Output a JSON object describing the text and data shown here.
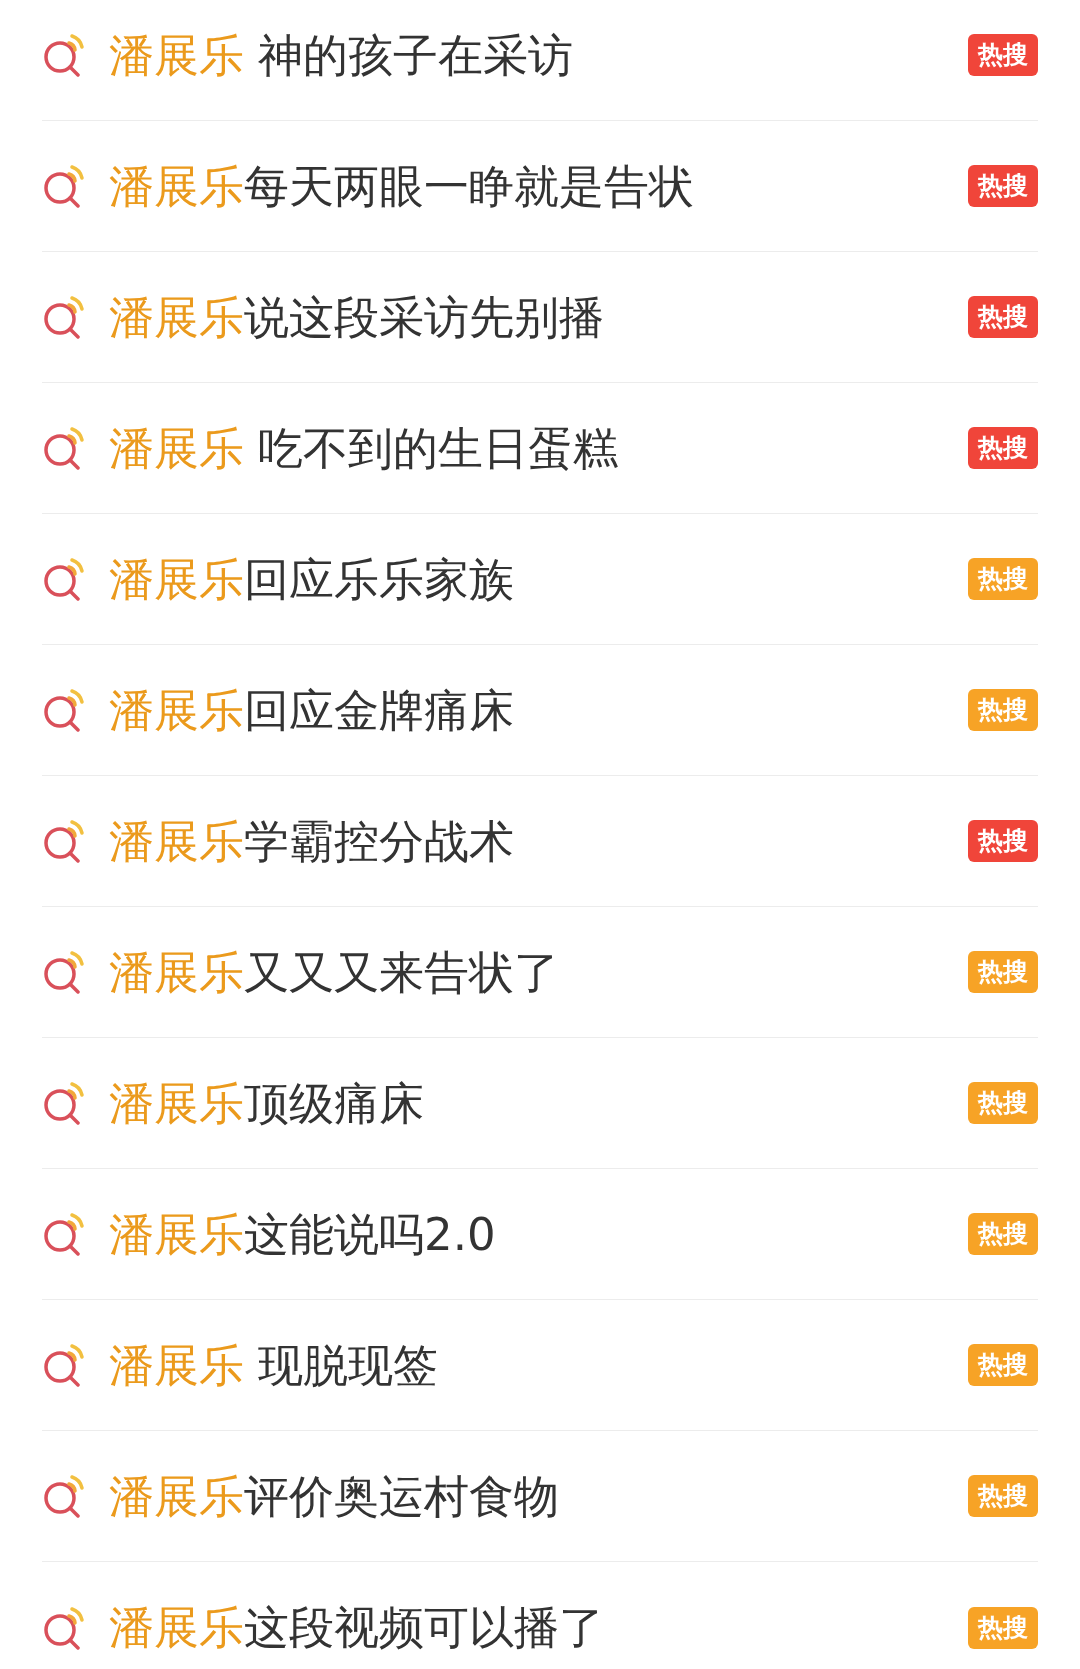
{
  "results": [
    {
      "keyword": "潘展乐",
      "text": " 神的孩子在采访",
      "badge": {
        "text": "热搜",
        "color": "#f0453a"
      }
    },
    {
      "keyword": "潘展乐",
      "text": "每天两眼一睁就是告状",
      "badge": {
        "text": "热搜",
        "color": "#f0453a"
      }
    },
    {
      "keyword": "潘展乐",
      "text": "说这段采访先别播",
      "badge": {
        "text": "热搜",
        "color": "#f0453a"
      }
    },
    {
      "keyword": "潘展乐",
      "text": " 吃不到的生日蛋糕",
      "badge": {
        "text": "热搜",
        "color": "#f0453a"
      }
    },
    {
      "keyword": "潘展乐",
      "text": "回应乐乐家族",
      "badge": {
        "text": "热搜",
        "color": "#f7a326"
      }
    },
    {
      "keyword": "潘展乐",
      "text": "回应金牌痛床",
      "badge": {
        "text": "热搜",
        "color": "#f7a326"
      }
    },
    {
      "keyword": "潘展乐",
      "text": "学霸控分战术",
      "badge": {
        "text": "热搜",
        "color": "#f0453a"
      }
    },
    {
      "keyword": "潘展乐",
      "text": "又又又来告状了",
      "badge": {
        "text": "热搜",
        "color": "#f7a326"
      }
    },
    {
      "keyword": "潘展乐",
      "text": "顶级痛床",
      "badge": {
        "text": "热搜",
        "color": "#f7a326"
      }
    },
    {
      "keyword": "潘展乐",
      "text": "这能说吗2.0",
      "badge": {
        "text": "热搜",
        "color": "#f7a326"
      }
    },
    {
      "keyword": "潘展乐",
      "text": " 现脱现签",
      "badge": {
        "text": "热搜",
        "color": "#f7a326"
      }
    },
    {
      "keyword": "潘展乐",
      "text": "评价奥运村食物",
      "badge": {
        "text": "热搜",
        "color": "#f7a326"
      }
    },
    {
      "keyword": "潘展乐",
      "text": "这段视频可以播了",
      "badge": {
        "text": "热搜",
        "color": "#f7a326"
      }
    }
  ]
}
